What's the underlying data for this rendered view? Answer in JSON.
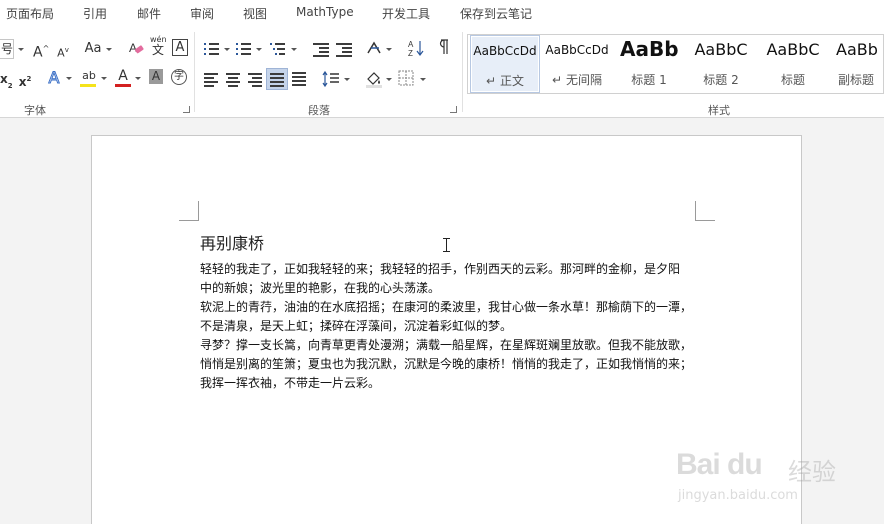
{
  "menu_tabs": [
    "页面布局",
    "引用",
    "邮件",
    "审阅",
    "视图",
    "MathType",
    "开发工具",
    "保存到云笔记"
  ],
  "ribbon": {
    "font_group": {
      "label": "字体",
      "size_fragment": "号",
      "grow": "A",
      "shrink": "A",
      "change_case": "Aa",
      "phonetic_top": "wén",
      "phonetic_bottom": "文",
      "char_border": "A",
      "subscript": "x",
      "subscript_mark": "2",
      "superscript": "x",
      "superscript_mark": "2",
      "text_effects": "A",
      "highlight": "ab",
      "font_color": "A",
      "char_shading": "A",
      "enclose": "字",
      "highlight_color": "#f5e31b",
      "font_color_value": "#d32020"
    },
    "paragraph_group": {
      "label": "段落"
    },
    "styles_group": {
      "label": "样式",
      "styles": [
        {
          "sample": "AaBbCcDd",
          "name": "正文",
          "prefix": "↵"
        },
        {
          "sample": "AaBbCcDd",
          "name": "无间隔",
          "prefix": "↵"
        },
        {
          "sample": "AaBb",
          "name": "标题 1",
          "prefix": ""
        },
        {
          "sample": "AaBbC",
          "name": "标题 2",
          "prefix": ""
        },
        {
          "sample": "AaBbC",
          "name": "标题",
          "prefix": ""
        },
        {
          "sample": "AaBb",
          "name": "副标题",
          "prefix": ""
        }
      ]
    }
  },
  "document": {
    "title": "再别康桥",
    "lines": [
      "轻轻的我走了，正如我轻轻的来；我轻轻的招手，作别西天的云彩。那河畔的金柳，是夕阳",
      "中的新娘；波光里的艳影，在我的心头荡漾。",
      "软泥上的青荇，油油的在水底招摇；在康河的柔波里，我甘心做一条水草！那榆荫下的一潭，",
      "不是清泉，是天上虹；揉碎在浮藻间，沉淀着彩虹似的梦。",
      "寻梦？撑一支长篙，向青草更青处漫溯；满载一船星辉，在星辉斑斓里放歌。但我不能放歌，",
      "悄悄是别离的笙箫；夏虫也为我沉默，沉默是今晚的康桥！悄悄的我走了，正如我悄悄的来；",
      "我挥一挥衣袖，不带走一片云彩。"
    ]
  },
  "watermark": {
    "logo": "Bai du",
    "cn": "经验",
    "url": "jingyan.baidu.com"
  }
}
